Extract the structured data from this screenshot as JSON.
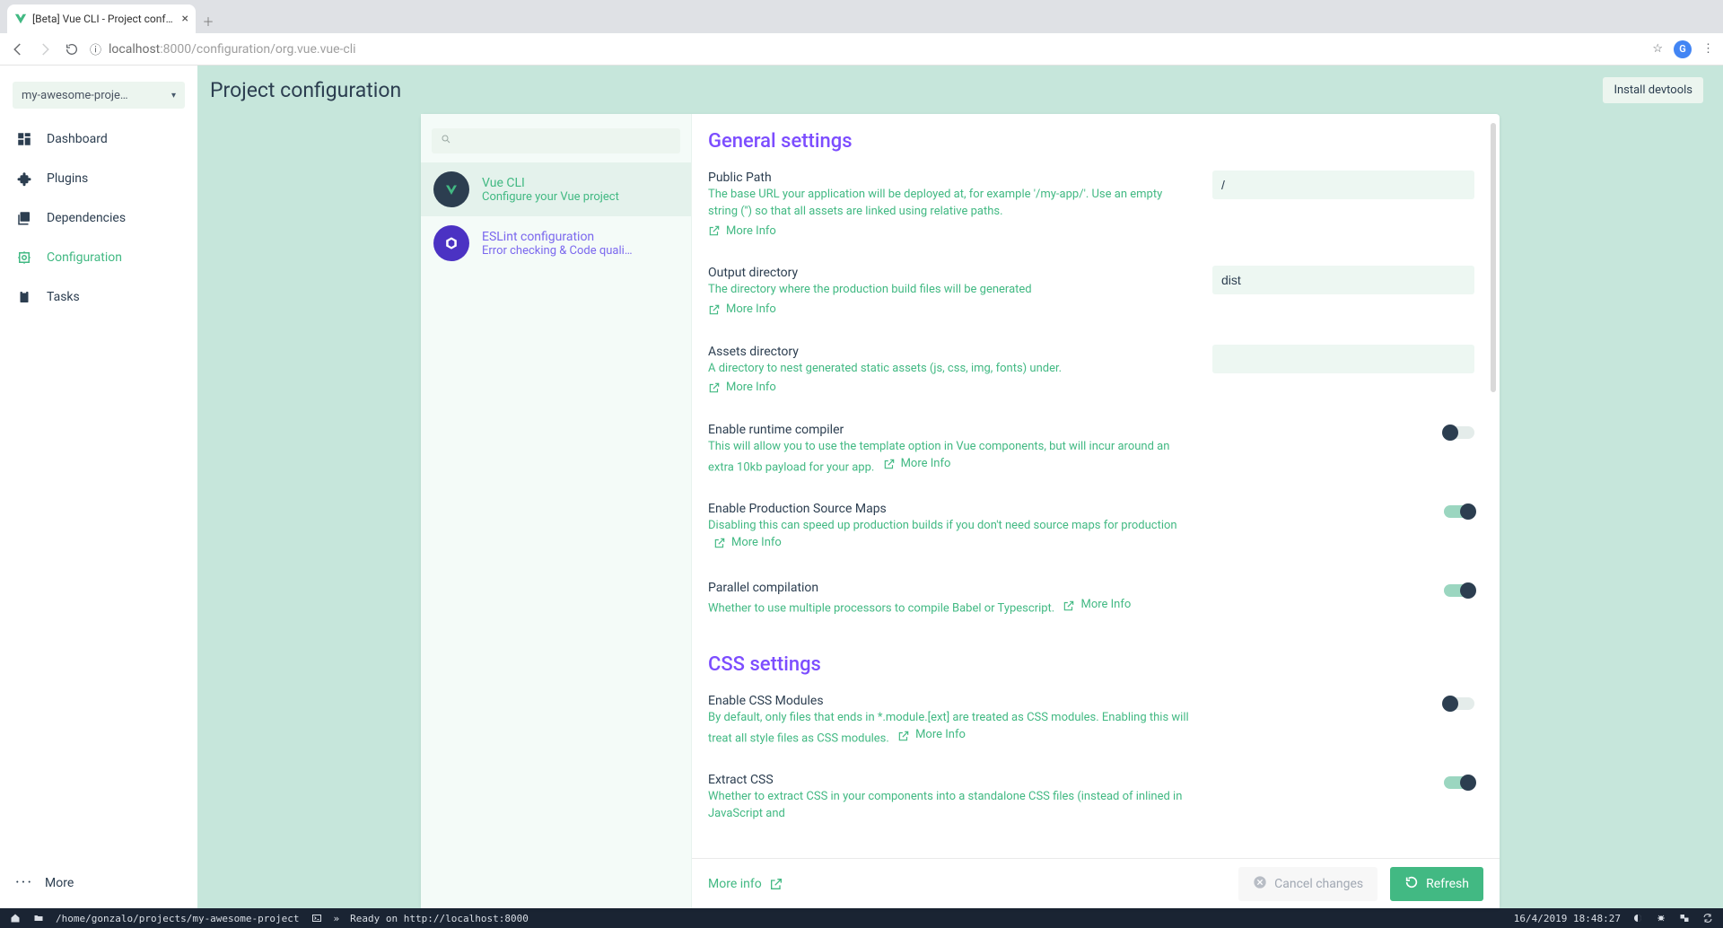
{
  "browser": {
    "tab_title": "[Beta] Vue CLI - Project conf…",
    "url_scheme": "ⓘ",
    "url_host": "localhost",
    "url_port": ":8000",
    "url_path": "/configuration/org.vue.vue-cli",
    "avatar_initial": "G"
  },
  "sidebar": {
    "project_name": "my-awesome-proje…",
    "items": [
      {
        "icon": "dashboard",
        "label": "Dashboard"
      },
      {
        "icon": "puzzle",
        "label": "Plugins"
      },
      {
        "icon": "book",
        "label": "Dependencies"
      },
      {
        "icon": "settings-alt",
        "label": "Configuration"
      },
      {
        "icon": "clipboard",
        "label": "Tasks"
      }
    ],
    "more_label": "More"
  },
  "header": {
    "page_title": "Project configuration",
    "install_label": "Install devtools"
  },
  "config_list": {
    "search_placeholder": "",
    "items": [
      {
        "title": "Vue CLI",
        "desc": "Configure your Vue project",
        "selected": true,
        "icon": "vue"
      },
      {
        "title": "ESLint configuration",
        "desc": "Error checking & Code quali…",
        "selected": false,
        "icon": "eslint"
      }
    ]
  },
  "sections": {
    "general_title": "General settings",
    "css_title": "CSS settings"
  },
  "settings": {
    "public_path": {
      "label": "Public Path",
      "desc": "The base URL your application will be deployed at, for example '/my-app/'. Use an empty string ('') so that all assets are linked using relative paths.",
      "value": "/",
      "more": "More Info"
    },
    "output_dir": {
      "label": "Output directory",
      "desc": "The directory where the production build files will be generated",
      "value": "dist",
      "more": "More Info"
    },
    "assets_dir": {
      "label": "Assets directory",
      "desc": "A directory to nest generated static assets (js, css, img, fonts) under.",
      "value": "",
      "more": "More Info"
    },
    "runtime_compiler": {
      "label": "Enable runtime compiler",
      "desc": "This will allow you to use the template option in Vue components, but will incur around an extra 10kb payload for your app.",
      "value": false,
      "more": "More Info"
    },
    "prod_sourcemaps": {
      "label": "Enable Production Source Maps",
      "desc": "Disabling this can speed up production builds if you don't need source maps for production",
      "value": true,
      "more": "More Info"
    },
    "parallel": {
      "label": "Parallel compilation",
      "desc": "Whether to use multiple processors to compile Babel or Typescript.",
      "value": true,
      "more": "More Info"
    },
    "css_modules": {
      "label": "Enable CSS Modules",
      "desc": "By default, only files that ends in *.module.[ext] are treated as CSS modules. Enabling this will treat all style files as CSS modules.",
      "value": false,
      "more": "More Info"
    },
    "extract_css": {
      "label": "Extract CSS",
      "desc": "Whether to extract CSS in your components into a standalone CSS files (instead of inlined in JavaScript and",
      "value": true
    }
  },
  "footer": {
    "more_info": "More info",
    "cancel": "Cancel changes",
    "refresh": "Refresh"
  },
  "taskbar": {
    "path": "/home/gonzalo/projects/my-awesome-project",
    "term": "Ready on http://localhost:8000",
    "prefix": "»",
    "datetime": "16/4/2019 18:48:27"
  }
}
